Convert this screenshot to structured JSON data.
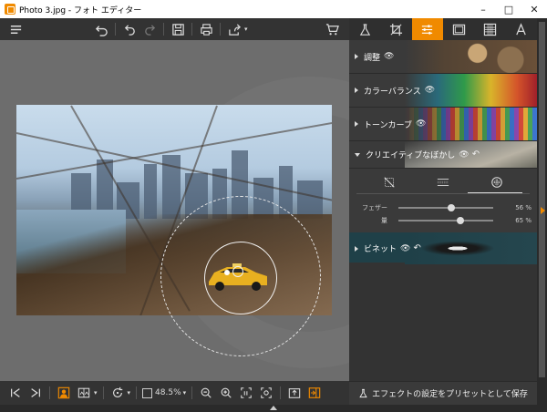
{
  "window": {
    "title": "Photo 3.jpg - フォト エディター",
    "minimize": "–",
    "maximize": "□",
    "close": "✕"
  },
  "toolbar": {
    "icons": [
      "menu-icon",
      "undo-all-icon",
      "undo-icon",
      "redo-icon",
      "save-icon",
      "print-icon",
      "share-icon",
      "cart-icon"
    ]
  },
  "panel_tabs": [
    "flask-icon",
    "crop-icon",
    "sliders-icon",
    "frame-icon",
    "texture-icon",
    "text-icon"
  ],
  "panel": {
    "sections": [
      {
        "label": "調整",
        "eye": "👁"
      },
      {
        "label": "カラーバランス",
        "eye": "👁"
      },
      {
        "label": "トーンカーブ",
        "eye": "👁"
      },
      {
        "label": "クリエイティブなぼかし",
        "eye": "👁",
        "undo": "↶"
      }
    ],
    "sliders": [
      {
        "label": "フェザー",
        "value": "56 %",
        "level": 0.56
      },
      {
        "label": "量",
        "value": "65 %",
        "level": 0.65
      }
    ],
    "vignette": {
      "label": "ビネット",
      "eye": "👁",
      "undo": "↶"
    },
    "preset_label": "エフェクトの設定をプリセットとして保存"
  },
  "bottombar": {
    "zoom": "48.5%"
  },
  "colors": {
    "accent": "#f08a00",
    "panel_bg": "#3a3a3a",
    "canvas_bg": "#6d6d6d"
  }
}
